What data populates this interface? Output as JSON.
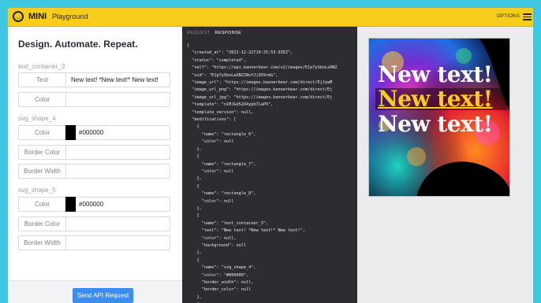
{
  "topbar": {
    "brand": "MINI",
    "subtitle": "Playground",
    "options_label": "OPTIONS"
  },
  "form": {
    "heading": "Design. Automate. Repeat.",
    "sections": {
      "text_container": "text_container_3",
      "svg4": "svg_shape_4",
      "svg5": "svg_shape_5"
    },
    "labels": {
      "text": "Text",
      "color": "Color",
      "border_color": "Border Color",
      "border_width": "Border Width"
    },
    "values": {
      "text": "New text! *New text!* New text!",
      "text_color": "",
      "svg4_color": "#000000",
      "svg4_border_color": "",
      "svg4_border_width": "",
      "svg5_color": "#000000",
      "svg5_border_color": "",
      "svg5_border_width": ""
    },
    "swatch_color": "#000000",
    "send_button": "Send API Request"
  },
  "code": {
    "tabs": [
      "REQUEST",
      "RESPONSE"
    ],
    "active_tab": "RESPONSE",
    "response_json": "{\n  \"created_at\": \"2022-12-22T10:25:53.035Z\",\n  \"status\": \"completed\",\n  \"self\": \"https://api.bannerbear.com/v2/images/E1p7ySbnLaXNZ\n  \"uid\": \"E1p7ySbnLaXNZ2NvYJjOX9rmG\",\n  \"image_url\": \"https://images.bannerbear.com/direct/EjJywM\n  \"image_url_png\": \"https://images.bannerbear.com/direct/Ej\n  \"image_url_jpg\": \"https://images.bannerbear.com/direct/Ej\n  \"template\": \"n1MJGd52O4ypb7LaPV\",\n  \"template_version\": null,\n  \"modifications\": [\n    {\n      \"name\": \"rectangle_6\",\n      \"color\": null\n    },\n    {\n      \"name\": \"rectangle_7\",\n      \"color\": null\n    },\n    {\n      \"name\": \"rectangle_8\",\n      \"color\": null\n    },\n    {\n      \"name\": \"text_container_3\",\n      \"text\": \"New text! *New text!* New text!\",\n      \"color\": null,\n      \"background\": null\n    },\n    {\n      \"name\": \"svg_shape_4\",\n      \"color\": \"#000000\",\n      \"border_width\": null,\n      \"border_color\": null\n    },\n    {\n      \"name\": \"svg_shape_5\","
  },
  "preview": {
    "lines": [
      "New text!",
      "New text!",
      "New text!"
    ]
  }
}
